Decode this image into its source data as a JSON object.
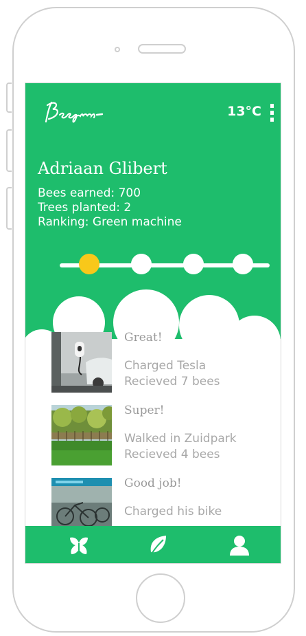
{
  "header": {
    "logo_text": "Beegreen",
    "temperature": "13°C"
  },
  "profile": {
    "name": "Adriaan Glibert",
    "bees_earned": "Bees earned: 700",
    "trees_planted": "Trees planted: 2",
    "ranking": "Ranking: Green machine"
  },
  "progress": {
    "total_steps": 4,
    "current_step": 1
  },
  "feed": [
    {
      "title": "Great!",
      "description": "Charged Tesla",
      "reward": "Recieved 7 bees",
      "thumbnail": "tesla-charging-photo"
    },
    {
      "title": "Super!",
      "description": "Walked in Zuidpark",
      "reward": "Recieved 4 bees",
      "thumbnail": "park-photo"
    },
    {
      "title": "Good job!",
      "description": "Charged his bike",
      "reward": "",
      "thumbnail": "bike-station-photo"
    }
  ],
  "bottom_nav": [
    {
      "icon": "bee-icon"
    },
    {
      "icon": "leaf-icon"
    },
    {
      "icon": "person-icon"
    }
  ],
  "colors": {
    "brand_green": "#1ebd6c",
    "active_dot": "#f8c81a",
    "feed_text": "#a8a8a8"
  }
}
